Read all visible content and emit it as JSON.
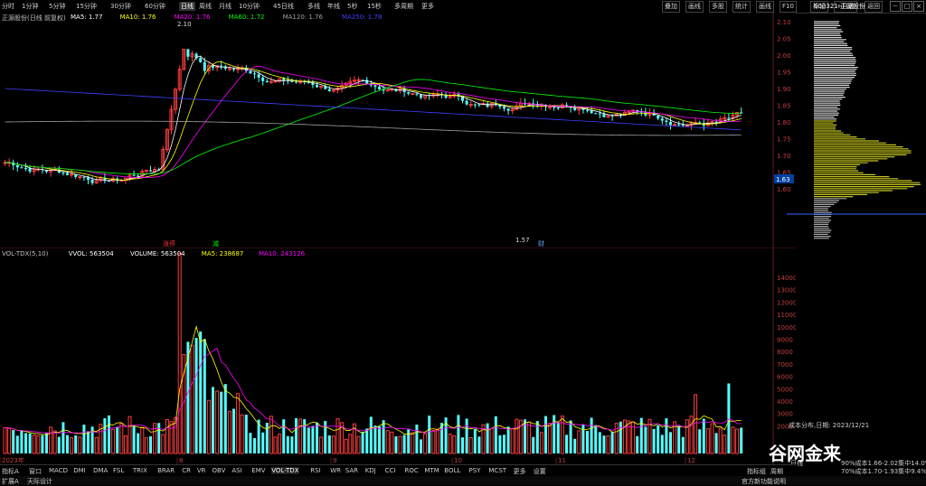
{
  "toolbar": {
    "timeframes": [
      "分时",
      "1分钟",
      "5分钟",
      "15分钟",
      "30分钟",
      "60分钟",
      "日线",
      "周线",
      "月线",
      "10分钟",
      "45日线",
      "多线",
      "年线",
      "5秒",
      "15秒",
      "多周期",
      "更多"
    ],
    "active": "日线",
    "right_buttons": [
      "叠加",
      "画线",
      "多股",
      "统计",
      "画线",
      "F10",
      "标记",
      "+自选",
      "返回"
    ],
    "code": "600321",
    "name": "正源股份"
  },
  "price_panel": {
    "title": "正源股份(日线 前复权)",
    "legend": [
      {
        "label": "MA5: 1.77",
        "color": "#ffffff"
      },
      {
        "label": "MA10: 1.76",
        "color": "#ffff00"
      },
      {
        "label": "MA20: 1.76",
        "color": "#ff00ff"
      },
      {
        "label": "MA60: 1.72",
        "color": "#00ff00"
      },
      {
        "label": "MA120: 1.76",
        "color": "#a0a0a0"
      },
      {
        "label": "MA250: 1.78",
        "color": "#4040ff"
      }
    ],
    "high_label": "2.10",
    "low_label": "1.57",
    "price_axis": [
      "2.10",
      "2.05",
      "2.00",
      "1.95",
      "1.90",
      "1.85",
      "1.80",
      "1.75",
      "1.70",
      "1.65",
      "1.60"
    ],
    "current_price": "1.63",
    "markers": [
      {
        "text": "涨停",
        "color": "#ff3333"
      },
      {
        "text": "减",
        "color": "#00ff00"
      },
      {
        "text": "财",
        "color": "#66aaff"
      }
    ]
  },
  "volume_panel": {
    "legend": [
      {
        "label": "VOL-TDX(5,10)",
        "color": "#c0c0c0"
      },
      {
        "label": "VVOL: 563504",
        "color": "#ffffff"
      },
      {
        "label": "VOLUME: 563504",
        "color": "#ffffff"
      },
      {
        "label": "MA5: 238687",
        "color": "#ffff00"
      },
      {
        "label": "MA10: 243126",
        "color": "#ff00ff"
      }
    ],
    "axis": [
      "14000",
      "13000",
      "12000",
      "11000",
      "10000",
      "9000",
      "8000",
      "7000",
      "6000",
      "5000",
      "4000",
      "3000",
      "2000"
    ],
    "months": [
      "2023年",
      "8",
      "9",
      "10",
      "11",
      "12"
    ]
  },
  "indicator_tabs": [
    "指标A",
    "窗口",
    "MACD",
    "DMI",
    "DMA",
    "FSL",
    "TRIX",
    "BRAR",
    "CR",
    "VR",
    "OBV",
    "ASI",
    "EMV",
    "VOL-TDX",
    "RSI",
    "WR",
    "SAR",
    "KDJ",
    "CCI",
    "ROC",
    "MTM",
    "BOLL",
    "PSY",
    "MCST",
    "更多",
    "设置"
  ],
  "active_tab": "VOL-TDX",
  "status": {
    "left": "扩展A",
    "left2": "天际设计",
    "right": "官方新功能说明",
    "zoom": "指标组",
    "period": "周期"
  },
  "side_panel": {
    "title": "成本分布,日期: 2023/12/21",
    "rows": [
      "90%成本1.66-2.02集中14.0%",
      "70%成本1.70-1.93集中9.4%"
    ],
    "tabs": [
      "日线"
    ],
    "watermark": "谷网金来"
  }
}
